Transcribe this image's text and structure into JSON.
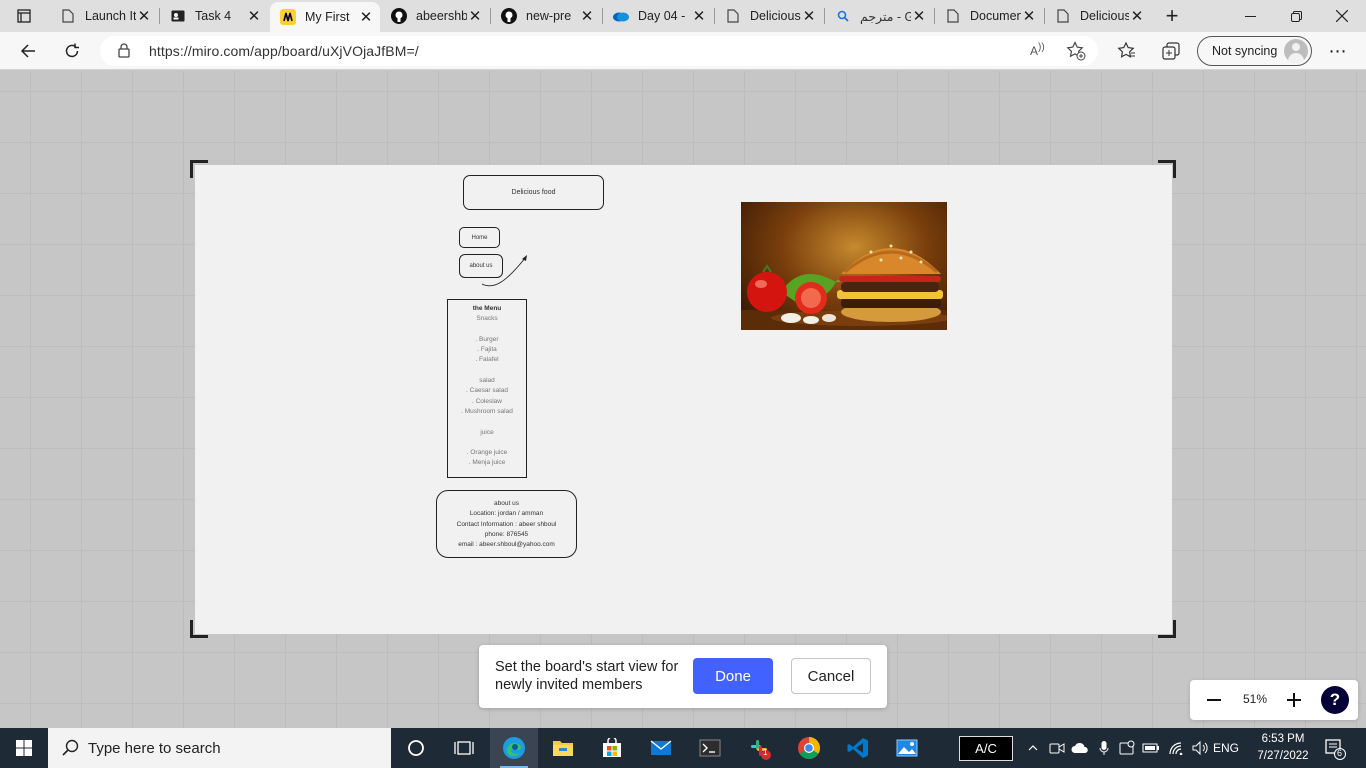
{
  "browser": {
    "tabs": [
      {
        "title": "Launch It",
        "icon": "document-icon"
      },
      {
        "title": "Task 4",
        "icon": "contact-card-icon"
      },
      {
        "title": "My First",
        "icon": "miro-icon",
        "active": true
      },
      {
        "title": "abeershbou",
        "icon": "github-icon"
      },
      {
        "title": "new-pre",
        "icon": "github-icon"
      },
      {
        "title": "Day 04 -",
        "icon": "onedrive-icon"
      },
      {
        "title": "Delicious",
        "icon": "document-icon"
      },
      {
        "title": "مترجم - Go",
        "icon": "search-icon"
      },
      {
        "title": "Document",
        "icon": "document-icon"
      },
      {
        "title": "Delicious",
        "icon": "document-icon"
      }
    ],
    "url": "https://miro.com/app/board/uXjVOjaJfBM=/",
    "read_aloud": "A",
    "sync_label": "Not syncing"
  },
  "board": {
    "title_node": "Delicious food",
    "home_node": "Home",
    "about_node": "about us",
    "menu": {
      "heading": "the Menu",
      "lines": [
        "Snacks",
        "",
        ". Burger",
        ". Fajita",
        ". Falafel",
        "",
        "salad",
        ". Caesar salad",
        ". Coleslaw",
        ". Mushroom salad",
        "",
        "juice",
        "",
        ". Orange juice",
        ". Menja juice"
      ]
    },
    "info": {
      "lines": [
        "about us",
        "Location: jordan / amman",
        "Contact Information : abeer shboul",
        "phone: 876545",
        "email : abeer.shboul@yahoo.com"
      ]
    }
  },
  "start_view_dialog": {
    "message": "Set the board's start view for newly invited members",
    "done_label": "Done",
    "cancel_label": "Cancel"
  },
  "zoom": {
    "level": "51%",
    "help": "?"
  },
  "taskbar": {
    "search_placeholder": "Type here to search",
    "ac_label": "A/C",
    "language": "ENG",
    "time": "6:53 PM",
    "date": "7/27/2022",
    "notification_count": "6",
    "slack_badge": "1"
  },
  "colors": {
    "accent": "#4262ff",
    "canvas": "#c6c6c6",
    "frame": "#f1f1f1",
    "taskbar": "#1f2a37"
  }
}
